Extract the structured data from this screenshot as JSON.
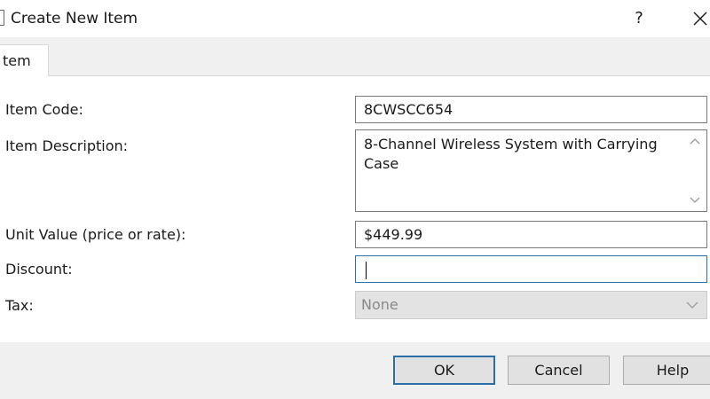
{
  "window": {
    "title": "Create New Item",
    "help_glyph": "?"
  },
  "tabs": [
    {
      "label": "tem",
      "selected": true
    }
  ],
  "form": {
    "item_code": {
      "label": "Item Code:",
      "value": "8CWSCC654"
    },
    "item_description": {
      "label": "Item Description:",
      "value": "8-Channel Wireless System with Carrying Case"
    },
    "unit_value": {
      "label": "Unit Value (price or rate):",
      "value": "$449.99"
    },
    "discount": {
      "label": "Discount:",
      "value": ""
    },
    "tax": {
      "label": "Tax:",
      "value": "None",
      "enabled": false
    }
  },
  "buttons": {
    "ok": "OK",
    "cancel": "Cancel",
    "help": "Help"
  },
  "colors": {
    "focus_border": "#2b6fa6",
    "field_border": "#7a7a7a",
    "disabled_fill": "#e3e3e3",
    "button_fill": "#e1e1e1"
  },
  "icons": {
    "close": "close-icon",
    "scroll_up": "chevron-up-icon",
    "scroll_down": "chevron-down-icon",
    "dropdown": "chevron-down-icon"
  }
}
